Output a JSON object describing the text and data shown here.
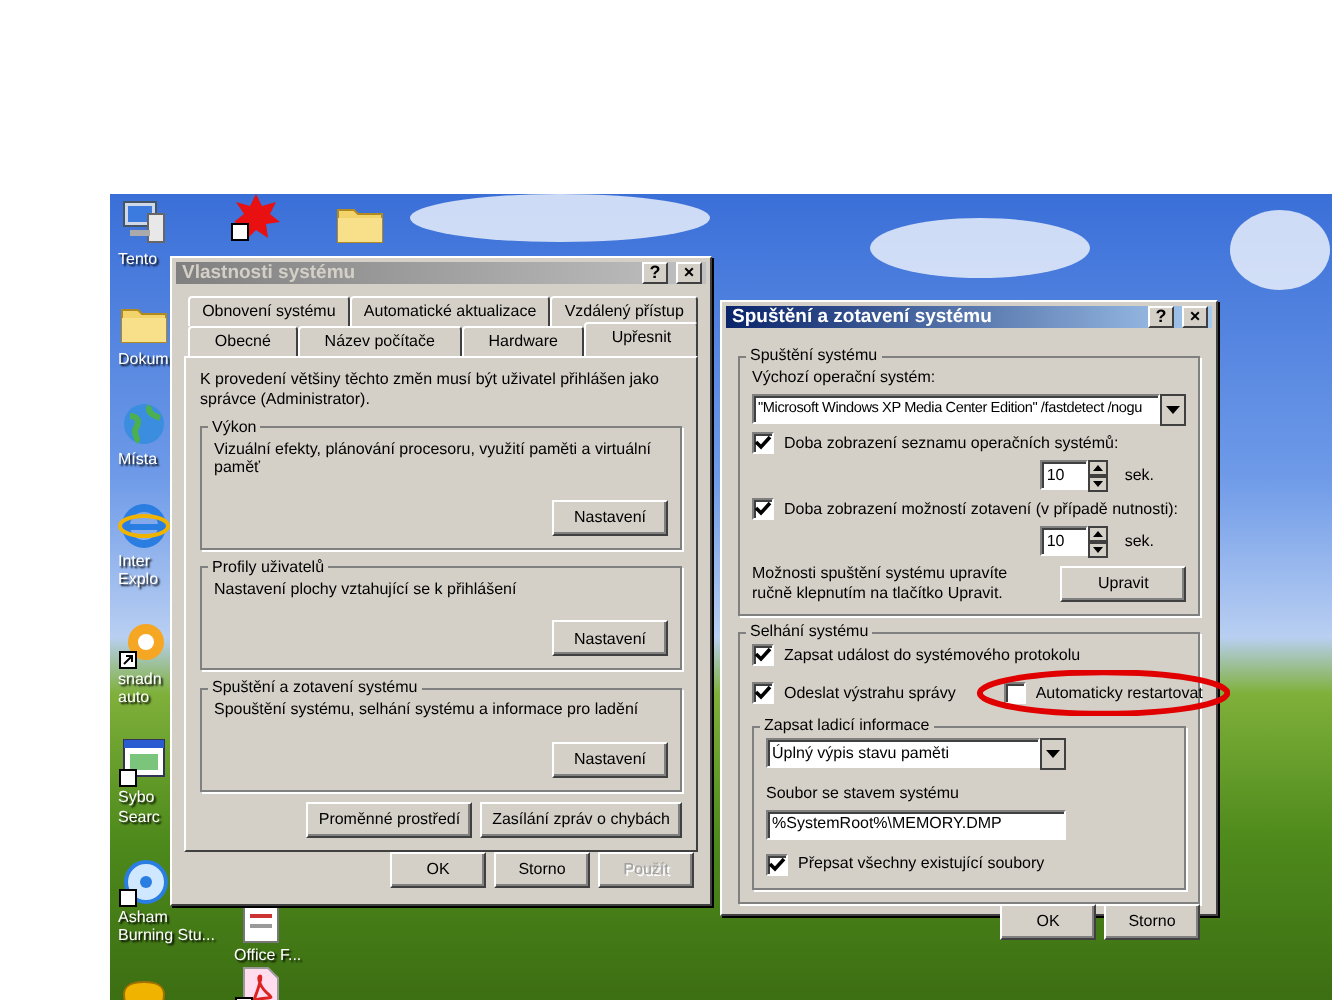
{
  "desktop_icons": {
    "column_1": [
      {
        "kind": "computer",
        "label": [
          "Tento"
        ]
      },
      {
        "kind": "folder",
        "label": [
          "Dokum"
        ]
      },
      {
        "kind": "globe",
        "label": [
          "Místa"
        ]
      },
      {
        "kind": "browser",
        "label": [
          "Inter",
          "Explo"
        ]
      },
      {
        "kind": "shortcut",
        "label": [
          "snadn",
          "auto"
        ]
      },
      {
        "kind": "window",
        "label": [
          "Sybo",
          "Searc"
        ]
      },
      {
        "kind": "disc",
        "label": [
          "Asham",
          "Burning Stu..."
        ]
      },
      {
        "kind": "gamepad"
      }
    ],
    "column_2_top": [
      {
        "kind": "splat"
      }
    ],
    "column_2_bottom": [
      {
        "kind": "document",
        "label": [
          "Office F..."
        ]
      },
      {
        "kind": "pdf"
      }
    ],
    "column_3": [
      {
        "kind": "folder"
      }
    ]
  },
  "system_properties": {
    "title": "Vlastnosti systému",
    "active": false,
    "title_buttons": [
      "?",
      "×"
    ],
    "tab_rows": [
      [
        {
          "label": "Obnovení systému",
          "selected": false
        },
        {
          "label": "Automatické aktualizace",
          "selected": false
        },
        {
          "label": "Vzdálený přístup",
          "selected": false
        }
      ],
      [
        {
          "label": "Obecné",
          "selected": false
        },
        {
          "label": "Název počítače",
          "selected": false
        },
        {
          "label": "Hardware",
          "selected": false
        },
        {
          "label": "Upřesnit",
          "selected": true
        }
      ]
    ],
    "intro": "K provedení většiny těchto změn musí být uživatel přihlášen jako správce (Administrator).",
    "groups": [
      {
        "title": "Výkon",
        "text": "Vizuální efekty, plánování procesoru, využití paměti a virtuální paměť",
        "button": "Nastavení"
      },
      {
        "title": "Profily uživatelů",
        "text": "Nastavení plochy vztahující se k přihlášení",
        "button": "Nastavení"
      },
      {
        "title": "Spuštění a zotavení systému",
        "text": "Spouštění systému, selhání systému a informace pro ladění",
        "button": "Nastavení"
      }
    ],
    "extra_buttons": [
      "Proměnné prostředí",
      "Zasílání zpráv o chybách"
    ],
    "buttons": [
      {
        "label": "OK",
        "disabled": false
      },
      {
        "label": "Storno",
        "disabled": false
      },
      {
        "label": "Použít",
        "disabled": true
      }
    ]
  },
  "startup_recovery": {
    "title": "Spuštění a zotavení systému",
    "active": true,
    "title_buttons": [
      "?",
      "×"
    ],
    "startup": {
      "title": "Spuštění systému",
      "default_os_label": "Výchozí operační systém:",
      "default_os": "\"Microsoft Windows XP Media Center Edition\" /fastdetect /nogu",
      "timeouts": [
        {
          "label": "Doba zobrazení seznamu operačních systémů:",
          "checked": true,
          "value": "10",
          "unit": "sek."
        },
        {
          "label": "Doba zobrazení možností zotavení (v případě nutnosti):",
          "checked": true,
          "value": "10",
          "unit": "sek."
        }
      ],
      "note": "Možnosti spuštění systému upravíte ručně klepnutím na tlačítko Upravit.",
      "button": "Upravit"
    },
    "failure": {
      "title": "Selhání systému",
      "options": [
        {
          "label": "Zapsat událost do systémového protokolu",
          "checked": true,
          "highlight": false
        },
        {
          "label": "Odeslat výstrahu správy",
          "checked": true,
          "highlight": false
        },
        {
          "label": "Automaticky restartovat",
          "checked": false,
          "highlight": true
        }
      ],
      "debug": {
        "title": "Zapsat ladicí informace",
        "dump_type": "Úplný výpis stavu paměti",
        "file_label": "Soubor se stavem systému",
        "file": "%SystemRoot%\\MEMORY.DMP",
        "overwrite": {
          "label": "Přepsat všechny existující soubory",
          "checked": true
        }
      }
    },
    "buttons": [
      {
        "label": "OK",
        "disabled": false
      },
      {
        "label": "Storno",
        "disabled": false
      }
    ]
  }
}
